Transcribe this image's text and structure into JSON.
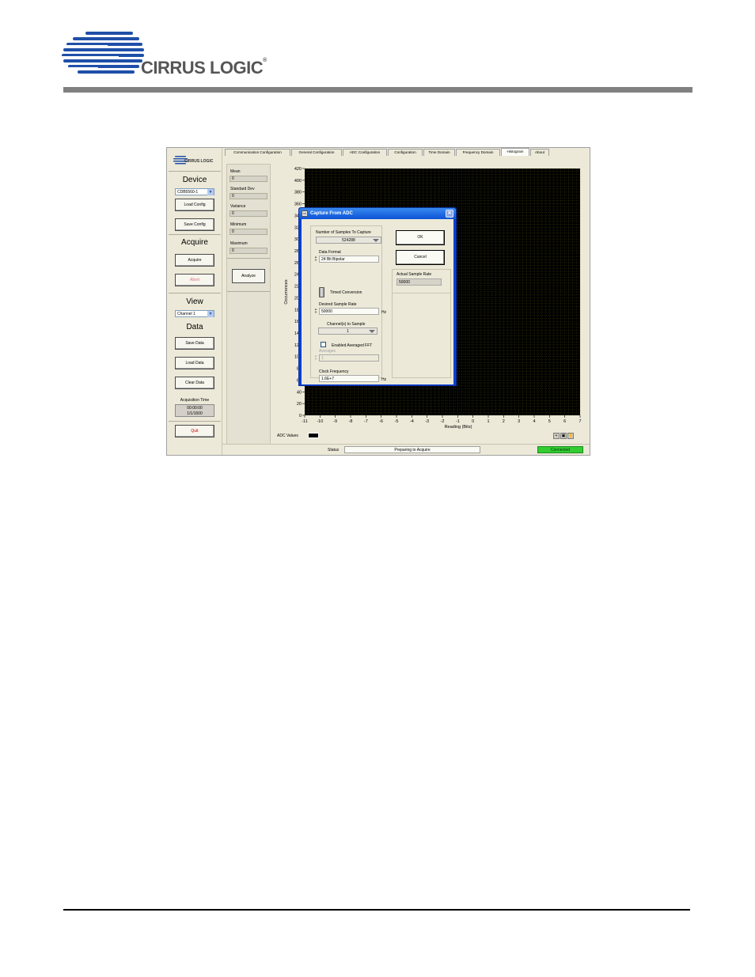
{
  "header": {
    "brand": "CIRRUS LOGIC",
    "trademark": "®"
  },
  "app": {
    "sidebar": {
      "brand": "CIRRUS LOGIC",
      "device_heading": "Device",
      "device_select": "CDB5560-1",
      "load_config": "Load Config",
      "save_config": "Save Config",
      "acquire_heading": "Acquire",
      "acquire_button": "Acquire",
      "abort_button": "Abort",
      "view_heading": "View",
      "channel_select": "Channel 1",
      "data_heading": "Data",
      "save_data": "Save Data",
      "load_data": "Load Data",
      "clear_data": "Clear Data",
      "acq_time_label": "Acquisition Time",
      "acq_time_line1": "00:00:00",
      "acq_time_line2": "1/1/1600",
      "quit_button": "Quit"
    },
    "stats": {
      "mean_label": "Mean",
      "mean_value": "0",
      "std_label": "Standard Dev",
      "std_value": "0",
      "var_label": "Variance",
      "var_value": "0",
      "min_label": "Minimum",
      "min_value": "0",
      "max_label": "Maximum",
      "max_value": "0",
      "analyze_button": "Analyze"
    },
    "tabs": [
      {
        "label": "Communication Configuration"
      },
      {
        "label": "General Configuration"
      },
      {
        "label": "ADC Configuration"
      },
      {
        "label": "Configuration"
      },
      {
        "label": "Time Domain"
      },
      {
        "label": "Frequency Domain"
      },
      {
        "label": "Histogram"
      },
      {
        "label": "About"
      }
    ],
    "active_tab": "Histogram",
    "bottom": {
      "adc_values_label": "ADC Values",
      "status_label": "Status",
      "status_text": "Preparing to Acquire",
      "connection": "Connected"
    }
  },
  "chart_data": {
    "type": "bar",
    "xlabel": "Reading (Bits)",
    "ylabel": "Occurrences",
    "xlim": [
      -11,
      7
    ],
    "ylim": [
      0,
      420
    ],
    "x_ticks": [
      -11,
      -10,
      -9,
      -8,
      -7,
      -6,
      -5,
      -4,
      -3,
      -2,
      -1,
      0,
      1,
      2,
      3,
      4,
      5,
      6,
      7
    ],
    "y_ticks": [
      0,
      20,
      40,
      60,
      80,
      100,
      120,
      140,
      160,
      180,
      200,
      220,
      240,
      260,
      280,
      300,
      320,
      340,
      360,
      380,
      400,
      420
    ],
    "grid": true,
    "background": "#000000",
    "grid_color": "#8a8a20",
    "values": []
  },
  "dialog": {
    "title": "Capture From ADC",
    "samples_label": "Number of Samples To Capture",
    "samples_value": "524288",
    "format_label": "Data Format",
    "format_value": "24 Bit Bipolar",
    "timed_label": "Timed Conversion",
    "rate_label": "Desired Sample Rate",
    "rate_value": "50000",
    "rate_unit": "Hz",
    "channels_label": "Channel(s) to Sample",
    "channels_value": "1",
    "avg_fft_label": "Enabled Averaged FFT",
    "averages_label": "Averages",
    "averages_value": "1",
    "clock_label": "Clock Frequency",
    "clock_value": "1.6E+7",
    "clock_unit": "Hz",
    "ok_button": "OK",
    "cancel_button": "Cancel",
    "actual_rate_label": "Actual Sample Rate",
    "actual_rate_value": "50000"
  }
}
